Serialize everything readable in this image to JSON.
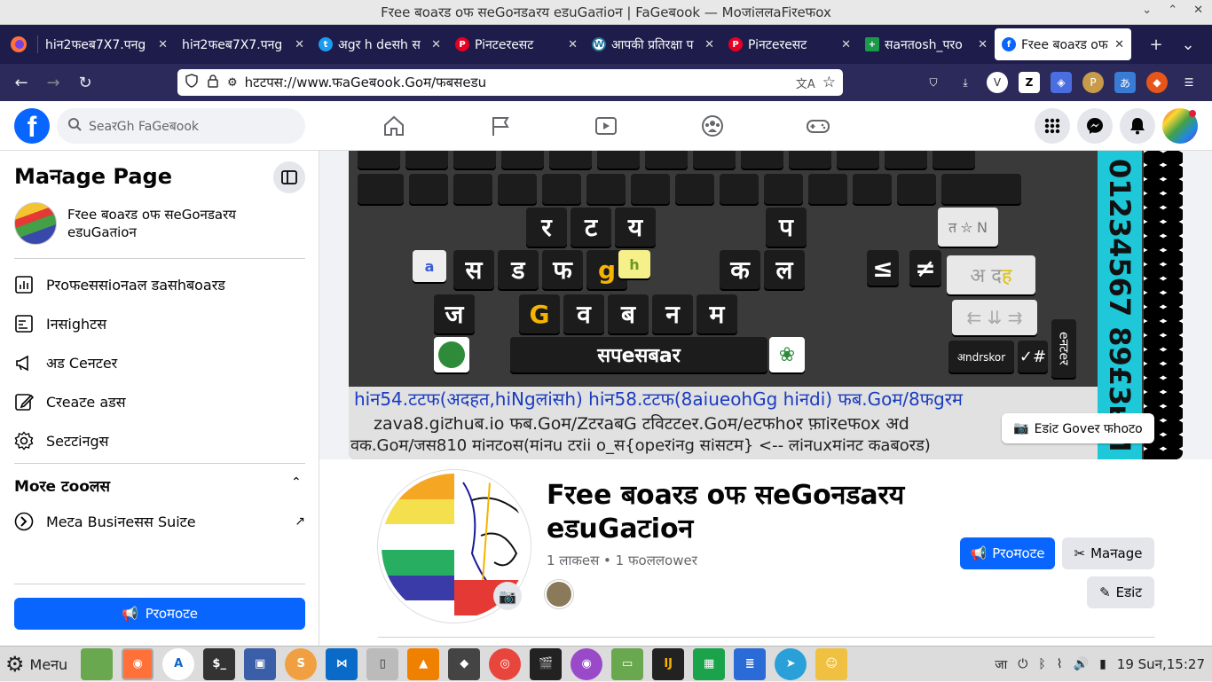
{
  "window": {
    "title": "Fरee बoaरड oफ सeGoनडaरय eडuGaतioन | FaGeबook — MoजiललaFiरeफox"
  },
  "tabs": [
    {
      "label": "hiन2फeब7X7.पनg",
      "favicon": "image-icon",
      "active": false
    },
    {
      "label": "hiन2फeब7X7.पनg",
      "favicon": "image-icon",
      "active": false
    },
    {
      "label": "अgर h deसh स",
      "favicon": "twitter-icon",
      "active": false
    },
    {
      "label": "Piनटeरeसट",
      "favicon": "pinterest-icon",
      "active": false
    },
    {
      "label": "आपकी प्रतिरक्षा प",
      "favicon": "wordpress-icon",
      "active": false
    },
    {
      "label": "Piनटeरeसट",
      "favicon": "pinterest-icon",
      "active": false
    },
    {
      "label": "सaनतosh_परo",
      "favicon": "green-cross-icon",
      "active": false
    },
    {
      "label": "Fरee बoaरड oफ",
      "favicon": "facebook-icon",
      "active": true
    }
  ],
  "urlbar": {
    "url": "hटटपस://www.फaGeबook.Goम/फबसeडu"
  },
  "fb": {
    "search_placeholder": "SeaरGh FaGeबook",
    "manage_page_title": "Maनage Page",
    "page_name": "Fरee बoaरड oफ सeGoनडaरय eडuGaतioन",
    "menu": [
      {
        "label": "Pरoफeससioनaल डaसhबoaरड",
        "icon": "dashboard-icon"
      },
      {
        "label": "Iनसighटस",
        "icon": "insights-icon"
      },
      {
        "label": "अड Ceनटeर",
        "icon": "megaphone-icon"
      },
      {
        "label": "Cरeaटe aडस",
        "icon": "pencil-icon"
      },
      {
        "label": "Seटटiनgस",
        "icon": "gear-icon"
      }
    ],
    "more_tools": "Moरe टooलस",
    "meta_suite": "Meटa Busiनeसस Suiटe",
    "promote_label": "Pरoमoटe",
    "edit_cover": "Eडiट Goveर फhoटo",
    "page_title_line1": "Fरee बoaरड oफ सeGoनडaरय",
    "page_title_line2": "eडuGaटioन",
    "stats": "1 लाकeस • 1 फoललoweर",
    "manage_label": "Maनage",
    "edit_label": "Eडiट"
  },
  "cover": {
    "row_blue": "hiन54.टटफ(अदहत,hiNgलiसh) hiन58.टटफ(8aiueohGg hiनdi) फब.Goम/8फgरम",
    "row_mid": "zava8.giटhuब.io फब.Goम/ZटरaबG टविटटeर.Goम/eटफhoर फ़ाiरeफox अd",
    "row_low": "वक.Goम/जस810 मiनटoस(मiनu टरii o_स{opeरiनg सiसटम} <-- लiनuxमiनट कaबoरड)",
    "side_text": "01234567 89£3ʁM"
  },
  "taskbar": {
    "menu": "Meनu",
    "lang": "जा",
    "clock": "19 Suन,15:27"
  }
}
